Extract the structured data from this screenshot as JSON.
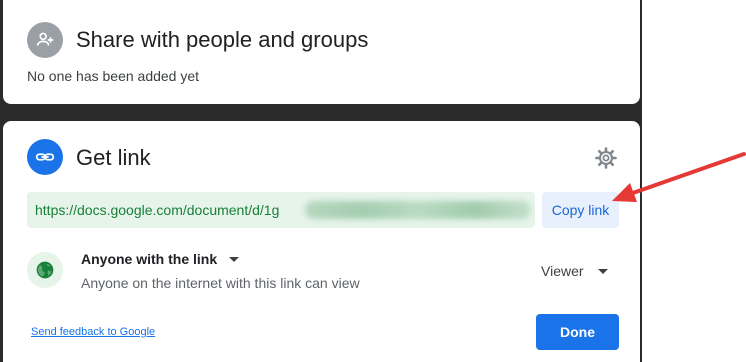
{
  "share_card": {
    "title": "Share with people and groups",
    "subtitle": "No one has been added yet",
    "icon": "person-add-icon"
  },
  "link_card": {
    "title": "Get link",
    "icon": "link-icon",
    "settings_icon": "gear-icon",
    "url_visible": "https://docs.google.com/document/d/1g",
    "copy_label": "Copy link",
    "access": {
      "label": "Anyone with the link",
      "description": "Anyone on the internet with this link can view",
      "icon": "globe-icon"
    },
    "role": "Viewer",
    "feedback_link": "Send feedback to Google",
    "done_label": "Done"
  },
  "colors": {
    "accent": "#1a73e8",
    "link_green": "#188038",
    "arrow_red": "#e53935"
  }
}
